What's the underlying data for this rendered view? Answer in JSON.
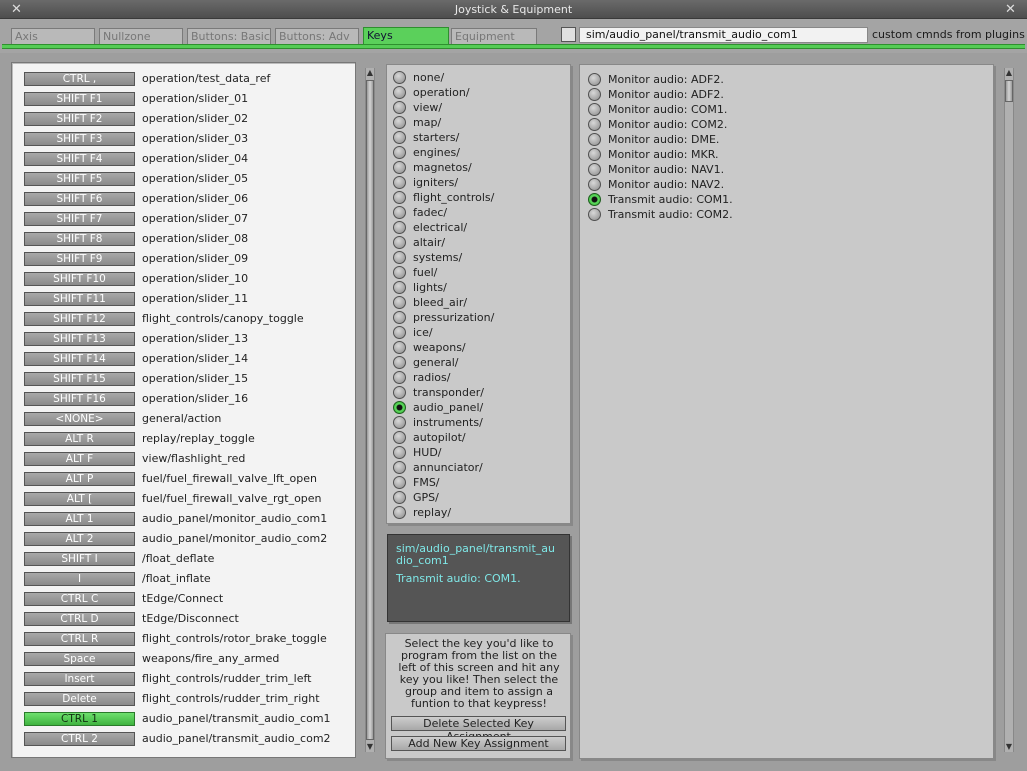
{
  "window": {
    "title": "Joystick & Equipment",
    "close_left": "✕",
    "close_right": "✕"
  },
  "tabs": [
    {
      "label": "Axis",
      "active": false
    },
    {
      "label": "Nullzone",
      "active": false
    },
    {
      "label": "Buttons: Basic",
      "active": false
    },
    {
      "label": "Buttons: Adv",
      "active": false
    },
    {
      "label": "Keys",
      "active": true
    },
    {
      "label": "Equipment",
      "active": false
    }
  ],
  "header": {
    "path_value": "sim/audio_panel/transmit_audio_com1",
    "custom_label": "custom cmnds from plugins"
  },
  "keys": [
    {
      "key": "CTRL ,",
      "cmd": "operation/test_data_ref"
    },
    {
      "key": "SHIFT F1",
      "cmd": "operation/slider_01"
    },
    {
      "key": "SHIFT F2",
      "cmd": "operation/slider_02"
    },
    {
      "key": "SHIFT F3",
      "cmd": "operation/slider_03"
    },
    {
      "key": "SHIFT F4",
      "cmd": "operation/slider_04"
    },
    {
      "key": "SHIFT F5",
      "cmd": "operation/slider_05"
    },
    {
      "key": "SHIFT F6",
      "cmd": "operation/slider_06"
    },
    {
      "key": "SHIFT F7",
      "cmd": "operation/slider_07"
    },
    {
      "key": "SHIFT F8",
      "cmd": "operation/slider_08"
    },
    {
      "key": "SHIFT F9",
      "cmd": "operation/slider_09"
    },
    {
      "key": "SHIFT F10",
      "cmd": "operation/slider_10"
    },
    {
      "key": "SHIFT F11",
      "cmd": "operation/slider_11"
    },
    {
      "key": "SHIFT F12",
      "cmd": "flight_controls/canopy_toggle"
    },
    {
      "key": "SHIFT F13",
      "cmd": "operation/slider_13"
    },
    {
      "key": "SHIFT F14",
      "cmd": "operation/slider_14"
    },
    {
      "key": "SHIFT F15",
      "cmd": "operation/slider_15"
    },
    {
      "key": "SHIFT F16",
      "cmd": "operation/slider_16"
    },
    {
      "key": "<NONE>",
      "cmd": "general/action"
    },
    {
      "key": "ALT R",
      "cmd": "replay/replay_toggle"
    },
    {
      "key": "ALT F",
      "cmd": "view/flashlight_red"
    },
    {
      "key": "ALT P",
      "cmd": "fuel/fuel_firewall_valve_lft_open"
    },
    {
      "key": "ALT [",
      "cmd": "fuel/fuel_firewall_valve_rgt_open"
    },
    {
      "key": "ALT 1",
      "cmd": "audio_panel/monitor_audio_com1"
    },
    {
      "key": "ALT 2",
      "cmd": "audio_panel/monitor_audio_com2"
    },
    {
      "key": "SHIFT I",
      "cmd": "/float_deflate"
    },
    {
      "key": "I",
      "cmd": "/float_inflate"
    },
    {
      "key": "CTRL C",
      "cmd": "tEdge/Connect"
    },
    {
      "key": "CTRL D",
      "cmd": "tEdge/Disconnect"
    },
    {
      "key": "CTRL R",
      "cmd": "flight_controls/rotor_brake_toggle"
    },
    {
      "key": "Space",
      "cmd": "weapons/fire_any_armed"
    },
    {
      "key": "Insert",
      "cmd": "flight_controls/rudder_trim_left"
    },
    {
      "key": "Delete",
      "cmd": "flight_controls/rudder_trim_right"
    },
    {
      "key": "CTRL 1",
      "cmd": "audio_panel/transmit_audio_com1",
      "active": true
    },
    {
      "key": "CTRL 2",
      "cmd": "audio_panel/transmit_audio_com2"
    }
  ],
  "groups": [
    {
      "label": "none/"
    },
    {
      "label": "operation/"
    },
    {
      "label": "view/"
    },
    {
      "label": "map/"
    },
    {
      "label": "starters/"
    },
    {
      "label": "engines/"
    },
    {
      "label": "magnetos/"
    },
    {
      "label": "igniters/"
    },
    {
      "label": "flight_controls/"
    },
    {
      "label": "fadec/"
    },
    {
      "label": "electrical/"
    },
    {
      "label": "altair/"
    },
    {
      "label": "systems/"
    },
    {
      "label": "fuel/"
    },
    {
      "label": "lights/"
    },
    {
      "label": "bleed_air/"
    },
    {
      "label": "pressurization/"
    },
    {
      "label": "ice/"
    },
    {
      "label": "weapons/"
    },
    {
      "label": "general/"
    },
    {
      "label": "radios/"
    },
    {
      "label": "transponder/"
    },
    {
      "label": "audio_panel/",
      "selected": true
    },
    {
      "label": "instruments/"
    },
    {
      "label": "autopilot/"
    },
    {
      "label": "HUD/"
    },
    {
      "label": "annunciator/"
    },
    {
      "label": "FMS/"
    },
    {
      "label": "GPS/"
    },
    {
      "label": "replay/"
    }
  ],
  "description": {
    "path": "sim/audio_panel/transmit_audio_com1",
    "text": "Transmit audio: COM1."
  },
  "help": {
    "text": "Select the key you'd like to program from the list on the left of this screen and hit any key you like! Then select the group and item to assign a funtion to that keypress!",
    "delete_label": "Delete Selected Key Assignment",
    "add_label": "Add New Key Assignment"
  },
  "commands": [
    {
      "label": "Monitor audio: ADF2."
    },
    {
      "label": "Monitor audio: ADF2."
    },
    {
      "label": "Monitor audio: COM1."
    },
    {
      "label": "Monitor audio: COM2."
    },
    {
      "label": "Monitor audio: DME."
    },
    {
      "label": "Monitor audio: MKR."
    },
    {
      "label": "Monitor audio: NAV1."
    },
    {
      "label": "Monitor audio: NAV2."
    },
    {
      "label": "Transmit audio: COM1.",
      "selected": true
    },
    {
      "label": "Transmit audio: COM2."
    }
  ]
}
